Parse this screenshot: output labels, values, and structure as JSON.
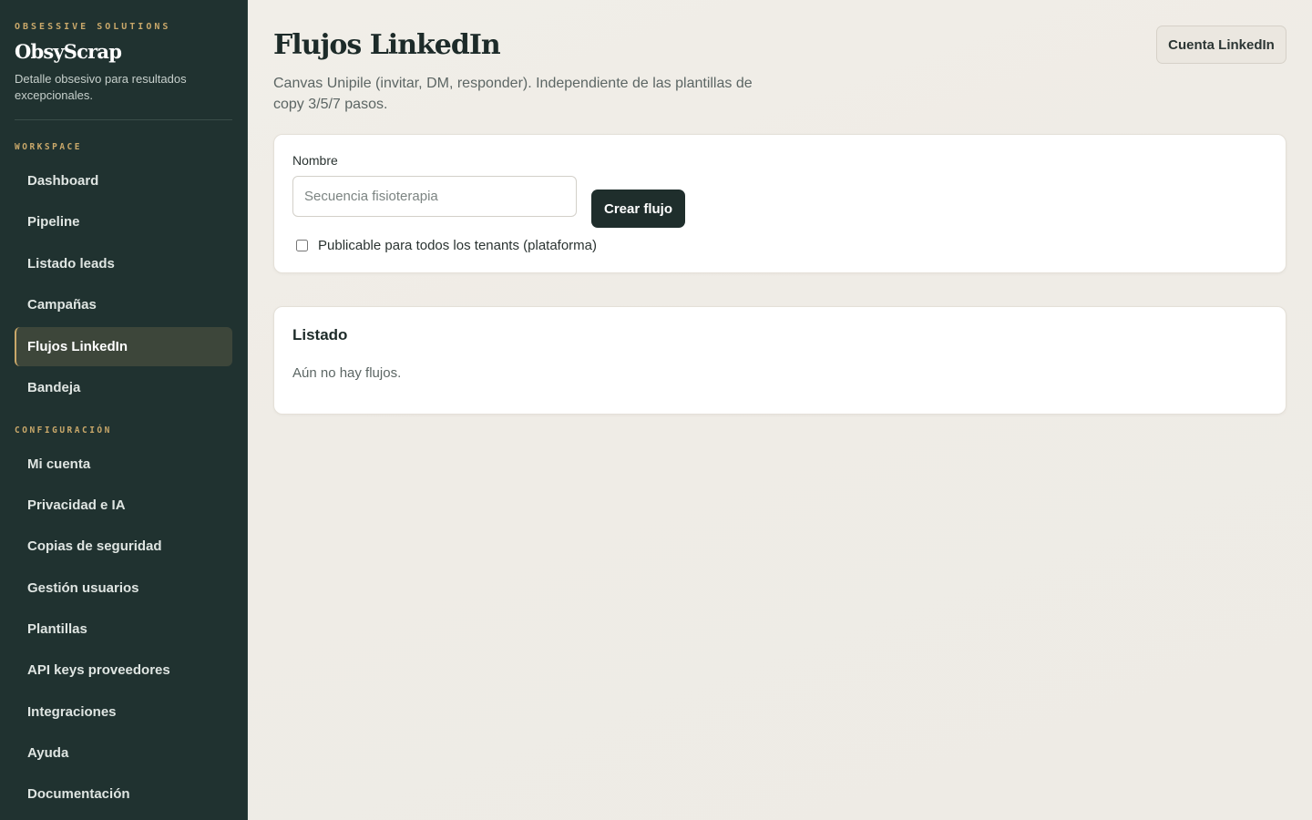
{
  "brand": {
    "kicker": "OBSESSIVE SOLUTIONS",
    "name": "ObsyScrap",
    "tagline": "Detalle obsesivo para resultados excepcionales."
  },
  "sidebar": {
    "workspace_label": "WORKSPACE",
    "workspace_items": [
      {
        "label": "Dashboard"
      },
      {
        "label": "Pipeline"
      },
      {
        "label": "Listado leads"
      },
      {
        "label": "Campañas"
      },
      {
        "label": "Flujos LinkedIn",
        "active": true
      },
      {
        "label": "Bandeja"
      }
    ],
    "config_label": "CONFIGURACIÓN",
    "config_items": [
      {
        "label": "Mi cuenta"
      },
      {
        "label": "Privacidad e IA"
      },
      {
        "label": "Copias de seguridad"
      },
      {
        "label": "Gestión usuarios"
      },
      {
        "label": "Plantillas"
      },
      {
        "label": "API keys proveedores"
      },
      {
        "label": "Integraciones"
      },
      {
        "label": "Ayuda"
      },
      {
        "label": "Documentación"
      }
    ]
  },
  "header": {
    "title": "Flujos LinkedIn",
    "subtitle": "Canvas Unipile (invitar, DM, responder). Independiente de las plantillas de copy 3/5/7 pasos.",
    "account_button": "Cuenta LinkedIn"
  },
  "form": {
    "name_label": "Nombre",
    "name_placeholder": "Secuencia fisioterapia",
    "name_value": "",
    "create_button": "Crear flujo",
    "publishable_label": "Publicable para todos los tenants (plataforma)",
    "publishable_checked": false
  },
  "list": {
    "title": "Listado",
    "empty_message": "Aún no hay flujos."
  },
  "colors": {
    "sidebar_bg": "#203230",
    "accent_gold": "#c9a86a",
    "active_item_bg": "#3d463a",
    "primary_button": "#1f2e2c",
    "page_bg": "#f1eee8"
  }
}
